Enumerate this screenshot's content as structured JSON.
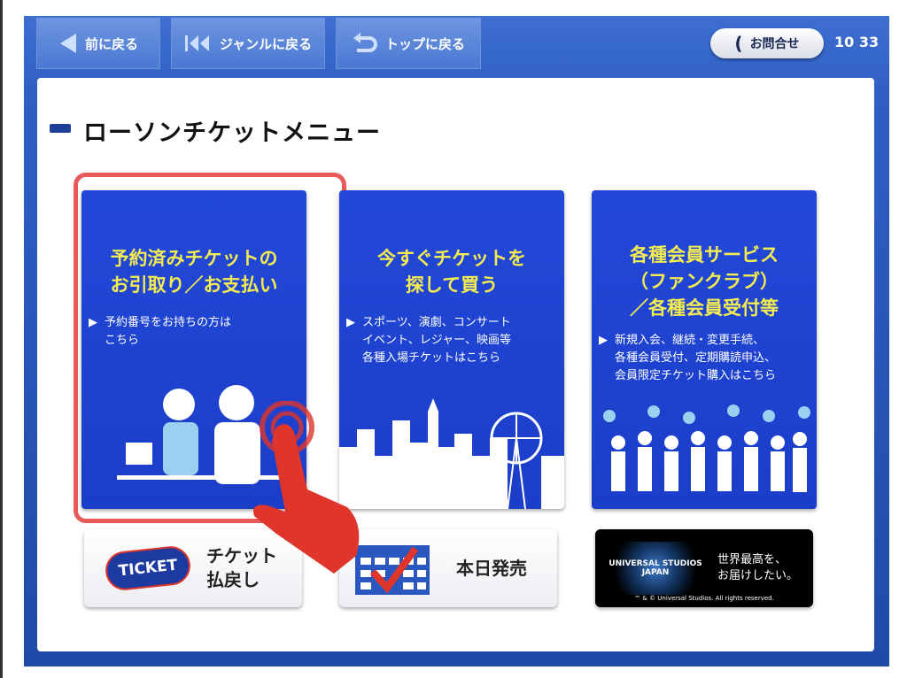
{
  "header": {
    "back_label": "前に戻る",
    "genre_back_label": "ジャンルに戻る",
    "top_back_label": "トップに戻る",
    "contact_label": "お問合せ",
    "clock": "10 33"
  },
  "page_title": "ローソンチケットメニュー",
  "cards": [
    {
      "title": "予約済みチケットの\nお引取り／お支払い",
      "desc": "予約番号をお持ちの方は\nこちら"
    },
    {
      "title": "今すぐチケットを\n探して買う",
      "desc": "スポーツ、演劇、コンサート\nイベント、レジャー、映画等\n各種入場チケットはこちら"
    },
    {
      "title": "各種会員サービス\n（ファンクラブ）\n／各種会員受付等",
      "desc": "新規入会、継続・変更手続、\n各種会員受付、定期購読申込、\n会員限定チケット購入はこちら"
    }
  ],
  "bottom": {
    "refund_label": "チケット\n払戻し",
    "ticket_logo": "TICKET",
    "today_label": "本日発売",
    "usj_logo": "UNIVERSAL STUDIOS JAPAN",
    "usj_tagline": "世界最高を、\nお届けしたい。",
    "usj_copyright": "™ & © Universal Studios.  All rights reserved."
  },
  "colors": {
    "card_blue": "#1b3ec9",
    "title_yellow": "#f4ec50",
    "highlight_red": "#e8595a",
    "hand_red": "#e0352b"
  }
}
